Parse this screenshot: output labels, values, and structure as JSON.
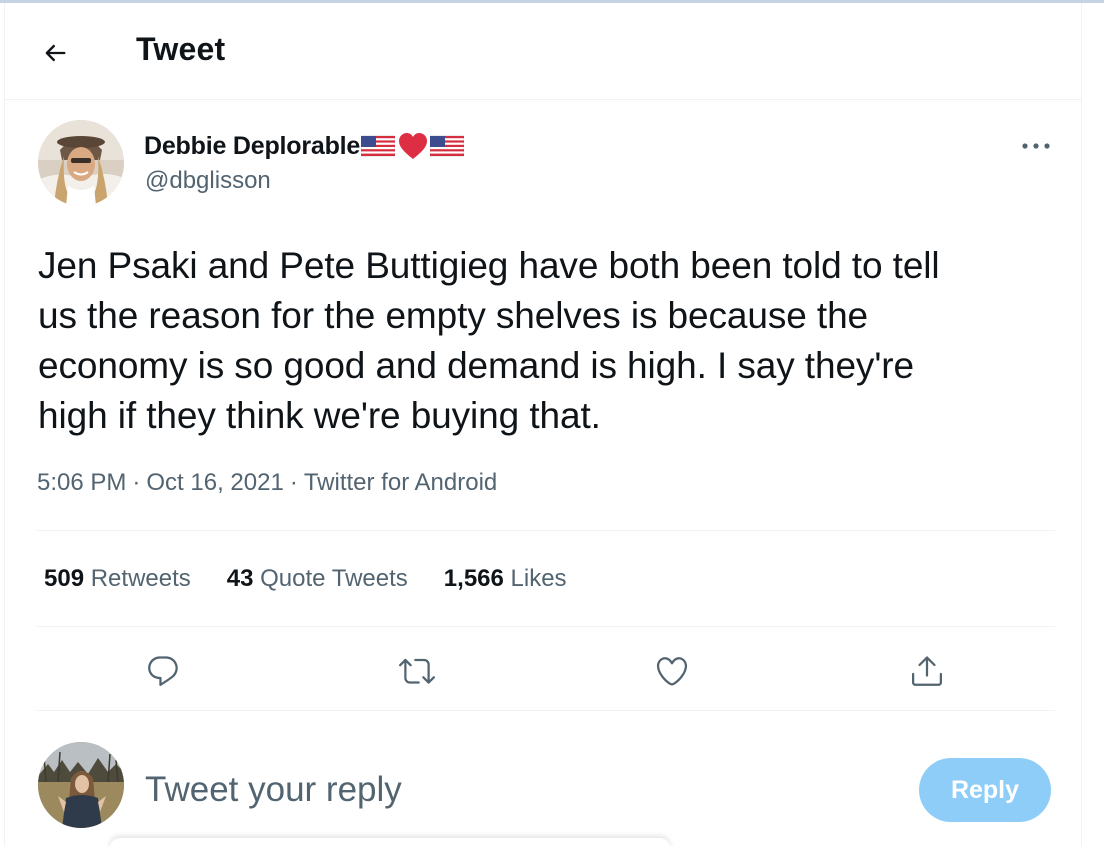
{
  "header": {
    "title": "Tweet"
  },
  "tweet": {
    "author": {
      "display_name": "Debbie Deplorable",
      "name_emojis": [
        "us-flag",
        "red-heart",
        "us-flag"
      ],
      "handle": "@dbglisson"
    },
    "text": "Jen Psaki and Pete Buttigieg have both been told to tell\nus the reason for the empty shelves is because the\neconomy is so good and demand is high. I say they're\nhigh if they think we're buying that.",
    "time": "5:06 PM",
    "date": "Oct 16, 2021",
    "source": "Twitter for Android",
    "separator": "·"
  },
  "stats": {
    "retweets": {
      "count": "509",
      "label": "Retweets"
    },
    "quote_tweets": {
      "count": "43",
      "label": "Quote Tweets"
    },
    "likes": {
      "count": "1,566",
      "label": "Likes"
    }
  },
  "actions": [
    "reply-icon",
    "retweet-icon",
    "like-icon",
    "share-icon"
  ],
  "reply_composer": {
    "placeholder": "Tweet your reply",
    "button_label": "Reply"
  },
  "colors": {
    "text_primary": "#0f1419",
    "text_secondary": "#536471",
    "divider": "#eff3f4",
    "reply_button_disabled": "#8ecdf8"
  }
}
